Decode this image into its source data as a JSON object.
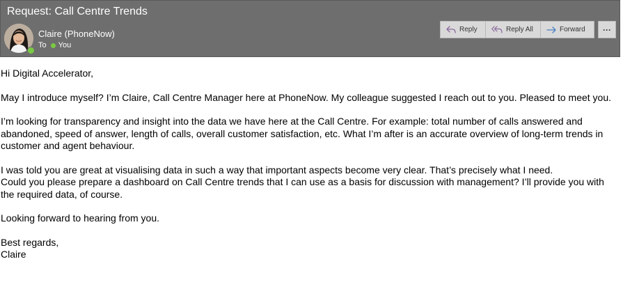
{
  "email": {
    "subject": "Request: Call Centre Trends",
    "sender": "Claire (PhoneNow)",
    "to_label": "To",
    "recipient": "You",
    "actions": {
      "reply": "Reply",
      "reply_all": "Reply All",
      "forward": "Forward",
      "more": "···"
    },
    "body": {
      "greeting": "Hi Digital Accelerator,",
      "para1": "May I introduce myself? I’m Claire, Call Centre Manager here at PhoneNow. My colleague suggested I reach out to you. Pleased to meet you.",
      "para2": "I’m looking for transparency and insight into the data we have here at the Call Centre. For example: total number of calls answered and abandoned, speed of answer, length of calls, overall customer satisfaction, etc. What I’m after is an accurate overview of long-term trends in customer and agent behaviour.",
      "para3_line1": "I was told you are great at visualising data in such a way that important aspects become very clear. That’s precisely what I need.",
      "para3_line2": "Could you please prepare a dashboard on Call Centre trends that I can use as a basis for discussion with management? I’ll provide you with the required data, of course.",
      "para4": "Looking forward to hearing from you.",
      "closing": "Best regards,",
      "signature": "Claire"
    }
  },
  "colors": {
    "header_bg": "#6e6e6e",
    "button_bg": "#d9d9d9",
    "presence": "#7ac943",
    "reply_icon": "#8a6a9c",
    "forward_icon": "#4a7fc1"
  },
  "icons": [
    "reply-icon",
    "reply-all-icon",
    "forward-icon",
    "more-icon",
    "presence-icon"
  ]
}
